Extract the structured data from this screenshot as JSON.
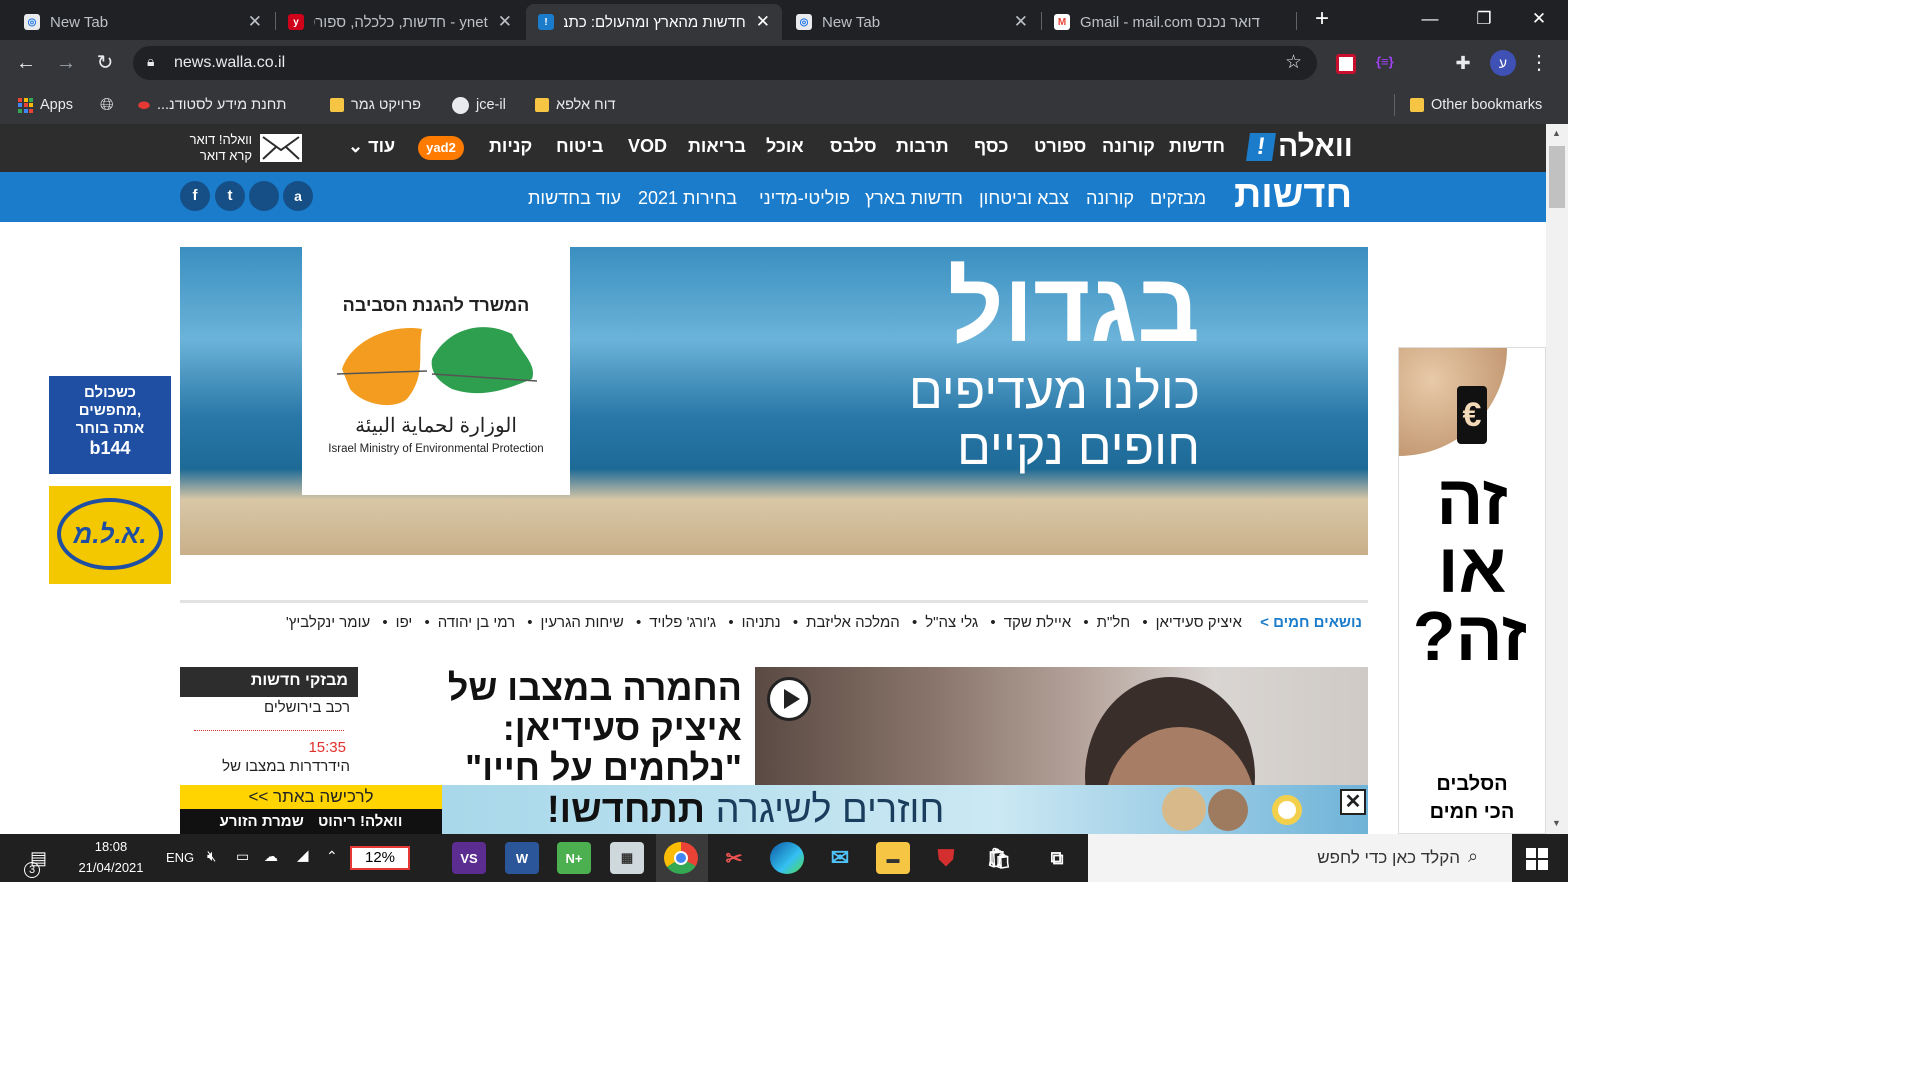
{
  "browser": {
    "tabs": [
      {
        "title": "New Tab",
        "favicon": "chrome-newtab-icon",
        "active": false
      },
      {
        "title": "ynet - חדשות, כלכלה, ספורט ובריאות מהארץ והעולם",
        "favicon": "ynet-icon",
        "active": false
      },
      {
        "title": "חדשות מהארץ ומהעולם: כתבות ועדכונים - וואלה! חדשות",
        "favicon": "walla-icon",
        "active": true
      },
      {
        "title": "New Tab",
        "favicon": "chrome-newtab-icon",
        "active": false
      },
      {
        "title": "דואר נכנס Gmail - mail.com",
        "favicon": "gmail-icon",
        "active": false
      }
    ],
    "new_tab": "+",
    "url": "news.walla.co.il",
    "profile_initial": "ע",
    "bookmarks": [
      {
        "label": "Apps",
        "icon": "apps-grid-icon"
      },
      {
        "label": "",
        "icon": "globe-icon"
      },
      {
        "label": "תחנת מידע לסטודנ...",
        "icon": "lips-icon"
      },
      {
        "label": "פרויקט גמר",
        "icon": "folder-icon"
      },
      {
        "label": "jce-il",
        "icon": "github-icon"
      },
      {
        "label": "דוח אלפא",
        "icon": "folder-icon"
      }
    ],
    "other_bookmarks": "Other bookmarks"
  },
  "site": {
    "logo": "וואלה",
    "main_nav": [
      "חדשות",
      "קורונה",
      "ספורט",
      "כסף",
      "תרבות",
      "סלבס",
      "אוכל",
      "בריאות",
      "VOD",
      "ביטוח",
      "קניות"
    ],
    "yad2": "yad2",
    "more": "עוד",
    "mail_line1": "וואלה! דואר",
    "mail_line2": "קרא דואר",
    "section_title": "חדשות",
    "sub_nav": [
      "מבזקים",
      "קורונה",
      "צבא וביטחון",
      "חדשות בארץ",
      "פוליטי-מדיני",
      "בחירות 2021",
      "עוד בחדשות"
    ],
    "social": [
      "f",
      "t",
      "",
      "a"
    ]
  },
  "banner": {
    "big": "בגדול",
    "line1": "כולנו מעדיפים",
    "line2": "חופים נקיים",
    "ministry_he": "המשרד להגנת הסביבה",
    "ministry_ar": "الوزارة لحماية البيئة",
    "ministry_en": "Israel Ministry of Environmental Protection"
  },
  "side_ads": {
    "b144_line1": "כשכולם",
    "b144_line2": "מחפשים,",
    "b144_line3": "אתה בוחר",
    "b144_brand": "b144",
    "alm": "א.ל.מ.",
    "right_big": "זה או זה?",
    "right_sub": "הסלבים הכי חמים"
  },
  "hot_topics": {
    "label": "נושאים חמים >",
    "items": [
      "איציק סעידיאן",
      "חל\"ת",
      "איילת שקד",
      "גלי צה\"ל",
      "המלכה אליזבת",
      "נתניהו",
      "ג'ורג' פלויד",
      "שיחות הגרעין",
      "רמי בן יהודה",
      "יפו",
      "עומר ינקלביץ'"
    ]
  },
  "article": {
    "headline_l1": "החמרה במצבו של",
    "headline_l2": "איציק סעידיאן:",
    "headline_l3": "\"נלחמים על חייו\""
  },
  "flashes": {
    "title": "מבזקי חדשות",
    "item1": "רכב בירושלים",
    "time2": "15:35",
    "item2": "הידרדרות במצבו של"
  },
  "bottom_ad": {
    "link": "לרכישה באתר >>",
    "brand": "וואלה! ריהוט",
    "brand2": "שמרת הזורע",
    "slogan_a": "חוזרים לשיגרה",
    "slogan_b": "תתחדשו!"
  },
  "taskbar": {
    "search_placeholder": "הקלד כאן כדי לחפש",
    "battery": "12%",
    "lang": "ENG",
    "time": "18:08",
    "date": "21/04/2021",
    "notif_count": "3"
  }
}
